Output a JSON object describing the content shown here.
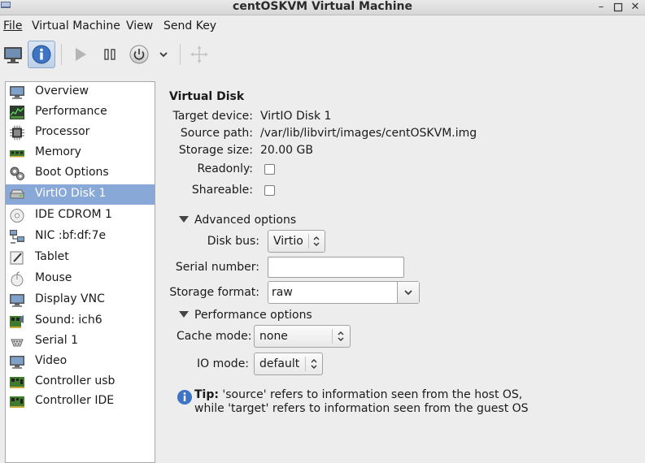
{
  "window": {
    "title": "centOSKVM Virtual Machine",
    "controls": [
      "minimize-icon",
      "maximize-icon",
      "close-icon"
    ]
  },
  "menubar": {
    "items": [
      {
        "label": "File",
        "mnemonic_index": 0
      },
      {
        "label": "Virtual Machine",
        "mnemonic_index": 8
      },
      {
        "label": "View",
        "mnemonic_index": 0
      },
      {
        "label": "Send Key",
        "mnemonic_index": 5
      }
    ]
  },
  "toolbar": {
    "buttons": [
      "console-monitor-icon",
      "details-info-icon",
      "run-play-icon",
      "pause-icon",
      "power-icon",
      "dropdown-chevron-icon",
      "fullscreen-move-icon"
    ],
    "active": "details-info-icon"
  },
  "sidebar": {
    "selected_index": 5,
    "items": [
      {
        "label": "Overview",
        "icon": "monitor-icon"
      },
      {
        "label": "Performance",
        "icon": "performance-chart-icon"
      },
      {
        "label": "Processor",
        "icon": "cpu-chip-icon"
      },
      {
        "label": "Memory",
        "icon": "memory-module-icon"
      },
      {
        "label": "Boot Options",
        "icon": "gears-icon"
      },
      {
        "label": "VirtIO Disk 1",
        "icon": "hard-disk-icon"
      },
      {
        "label": "IDE CDROM 1",
        "icon": "cdrom-icon"
      },
      {
        "label": "NIC :bf:df:7e",
        "icon": "network-icon"
      },
      {
        "label": "Tablet",
        "icon": "tablet-pen-icon"
      },
      {
        "label": "Mouse",
        "icon": "mouse-icon"
      },
      {
        "label": "Display VNC",
        "icon": "display-icon"
      },
      {
        "label": "Sound: ich6",
        "icon": "sound-card-icon"
      },
      {
        "label": "Serial 1",
        "icon": "serial-port-icon"
      },
      {
        "label": "Video",
        "icon": "video-monitor-icon"
      },
      {
        "label": "Controller usb",
        "icon": "controller-card-icon"
      },
      {
        "label": "Controller IDE",
        "icon": "controller-card-icon"
      }
    ]
  },
  "disk": {
    "section_title": "Virtual Disk",
    "target_device_label": "Target device:",
    "target_device": "VirtIO Disk 1",
    "source_path_label": "Source path:",
    "source_path": "/var/lib/libvirt/images/centOSKVM.img",
    "storage_size_label": "Storage size:",
    "storage_size": "20.00 GB",
    "readonly_label": "Readonly:",
    "readonly_checked": false,
    "shareable_label": "Shareable:",
    "shareable_checked": false,
    "advanced": {
      "label": "Advanced options",
      "disk_bus_label": "Disk bus:",
      "disk_bus": "Virtio",
      "serial_label": "Serial number:",
      "serial_value": "",
      "storage_format_label": "Storage format:",
      "storage_format": "raw"
    },
    "performance": {
      "label": "Performance options",
      "cache_mode_label": "Cache mode:",
      "cache_mode": "none",
      "io_mode_label": "IO mode:",
      "io_mode": "default"
    },
    "tip_bold": "Tip:",
    "tip_line1": " 'source' refers to information seen from the host OS,",
    "tip_line2": "while 'target' refers to information seen from the guest OS"
  }
}
